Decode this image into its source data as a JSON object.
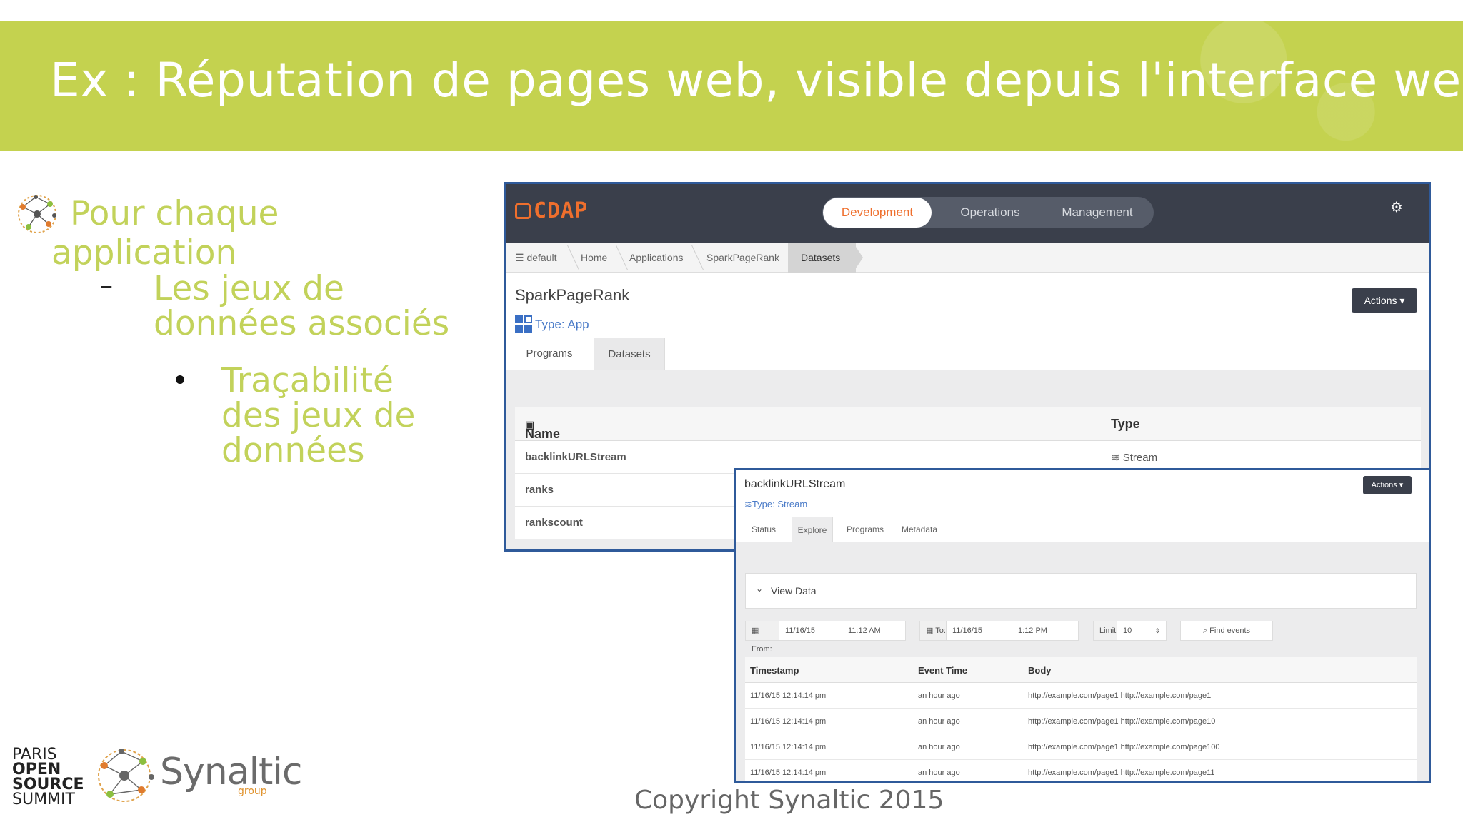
{
  "slide": {
    "title": "Ex : Réputation de pages web, visible depuis l'interface web",
    "bullets": {
      "level1_line1": "Pour chaque",
      "level1_line2": "application",
      "level2_line1": "Les jeux de",
      "level2_line2": "données associés",
      "level3_line1": "Traçabilité",
      "level3_line2": "des jeux de",
      "level3_line3": "données"
    },
    "dash": "–",
    "footer": {
      "pos_logo": [
        "PARIS",
        "OPEN",
        "SOURCE",
        "SUMMIT"
      ],
      "synaltic_word": "Synaltic",
      "synaltic_group": "group",
      "copyright": "Copyright Synaltic 2015"
    },
    "colors": {
      "band": "#c4d24f",
      "bullet_text": "#c2d25a",
      "frame_border": "#2f5a9a"
    }
  },
  "cdap": {
    "logo": "CDAP",
    "nav": {
      "development": "Development",
      "operations": "Operations",
      "management": "Management"
    },
    "breadcrumb": {
      "namespace": "default",
      "home": "Home",
      "applications": "Applications",
      "app": "SparkPageRank",
      "current": "Datasets"
    },
    "app": {
      "name": "SparkPageRank",
      "type": "Type: App",
      "actions": "Actions"
    },
    "tabs": {
      "programs": "Programs",
      "datasets": "Datasets"
    },
    "datasets_table": {
      "headers": {
        "name": "Name",
        "type": "Type"
      },
      "rows": [
        {
          "name": "backlinkURLStream",
          "type": "Stream"
        },
        {
          "name": "ranks",
          "type": ""
        },
        {
          "name": "rankscount",
          "type": ""
        }
      ]
    },
    "colors": {
      "topbar": "#3a3f4b",
      "accent": "#ef6f2d",
      "link": "#4a7bc8"
    }
  },
  "stream": {
    "name": "backlinkURLStream",
    "type": "Type: Stream",
    "actions": "Actions",
    "tabs": {
      "status": "Status",
      "explore": "Explore",
      "programs": "Programs",
      "metadata": "Metadata"
    },
    "view_data": "View Data",
    "filters": {
      "from_label": "From:",
      "from_date": "11/16/15",
      "from_time": "11:12 AM",
      "to_label": "To:",
      "to_date": "11/16/15",
      "to_time": "1:12 PM",
      "limit_label": "Limit",
      "limit_value": "10",
      "find": "Find events"
    },
    "events_table": {
      "headers": {
        "timestamp": "Timestamp",
        "event_time": "Event Time",
        "body": "Body"
      },
      "rows": [
        {
          "timestamp": "11/16/15 12:14:14 pm",
          "event_time": "an hour ago",
          "body": "http://example.com/page1 http://example.com/page1"
        },
        {
          "timestamp": "11/16/15 12:14:14 pm",
          "event_time": "an hour ago",
          "body": "http://example.com/page1 http://example.com/page10"
        },
        {
          "timestamp": "11/16/15 12:14:14 pm",
          "event_time": "an hour ago",
          "body": "http://example.com/page1 http://example.com/page100"
        },
        {
          "timestamp": "11/16/15 12:14:14 pm",
          "event_time": "an hour ago",
          "body": "http://example.com/page1 http://example.com/page11"
        }
      ]
    }
  }
}
